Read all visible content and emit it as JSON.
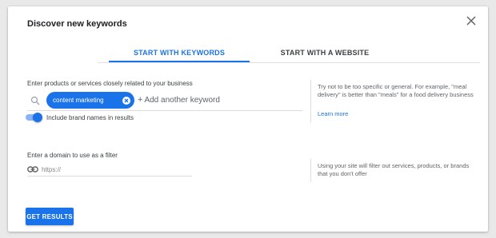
{
  "dialog": {
    "title": "Discover new keywords"
  },
  "tabs": [
    {
      "label": "START WITH KEYWORDS",
      "active": true
    },
    {
      "label": "START WITH A WEBSITE",
      "active": false
    }
  ],
  "keywords": {
    "label": "Enter products or services closely related to your business",
    "chips": [
      "content marketing"
    ],
    "add_placeholder": "Add another keyword",
    "brand_toggle_label": "Include brand names in results",
    "brand_toggle_on": true,
    "hint": "Try not to be too specific or general. For example, \"meal delivery\" is better than \"meals\" for a food delivery business",
    "learn_more": "Learn more"
  },
  "domain": {
    "label": "Enter a domain to use as a filter",
    "placeholder": "https://",
    "value": "",
    "hint": "Using your site will filter out services, products, or brands that you don't offer"
  },
  "actions": {
    "get_results_label": "GET RESULTS"
  },
  "icons": {
    "close": "close-icon",
    "search": "search-icon",
    "chip_remove": "cancel-circle-icon",
    "link": "link-icon"
  },
  "colors": {
    "accent": "#1a73e8",
    "toggle_track": "#8ab4f8",
    "text_primary": "#202124",
    "text_secondary": "#5f6368",
    "divider": "#e0e0e0"
  }
}
